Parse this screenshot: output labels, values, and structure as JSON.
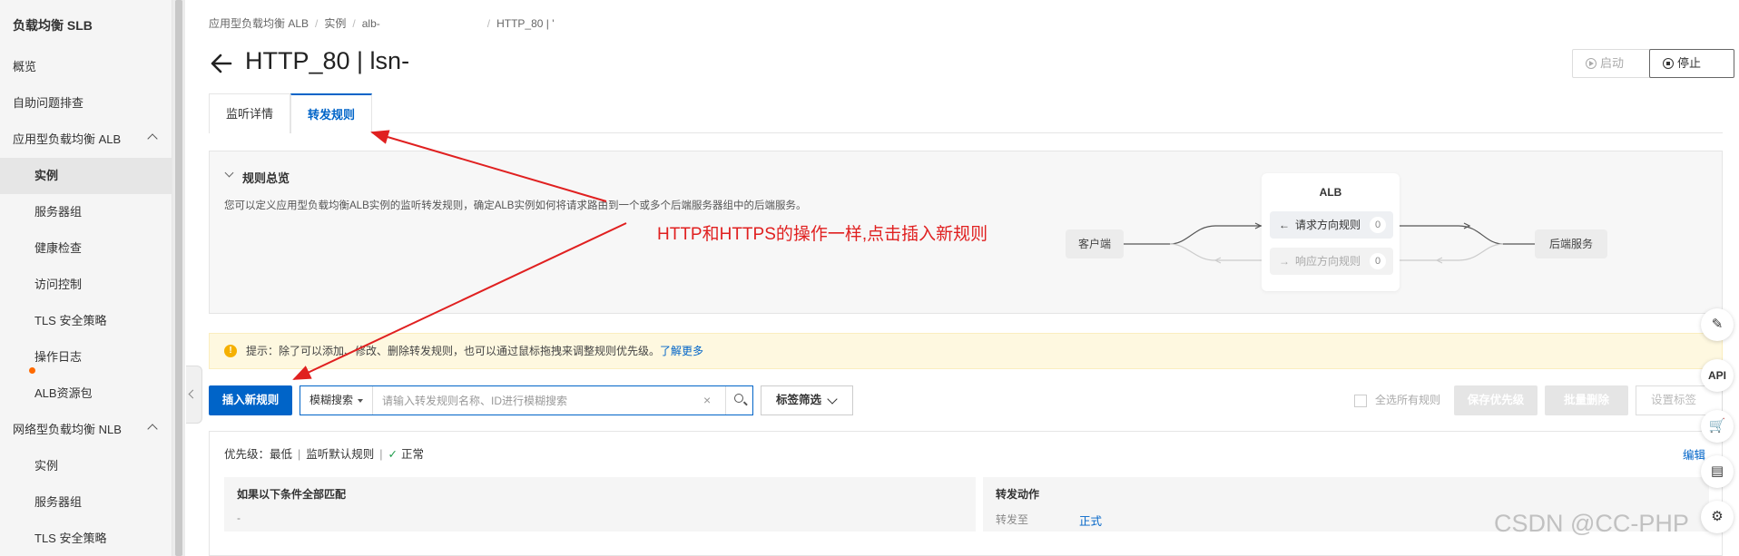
{
  "sidebar": {
    "title": "负载均衡 SLB",
    "items": [
      {
        "label": "概览"
      },
      {
        "label": "自助问题排查"
      },
      {
        "label": "应用型负载均衡 ALB"
      },
      {
        "label": "实例"
      },
      {
        "label": "服务器组"
      },
      {
        "label": "健康检查"
      },
      {
        "label": "访问控制"
      },
      {
        "label": "TLS 安全策略"
      },
      {
        "label": "操作日志"
      },
      {
        "label": "ALB资源包"
      },
      {
        "label": "网络型负载均衡 NLB"
      },
      {
        "label": "实例"
      },
      {
        "label": "服务器组"
      },
      {
        "label": "TLS 安全策略"
      }
    ]
  },
  "breadcrumb": {
    "items": [
      "应用型负载均衡 ALB",
      "实例",
      "alb-",
      "HTTP_80 | '"
    ]
  },
  "header": {
    "title": "HTTP_80 | lsn-",
    "start_label": "启动",
    "stop_label": "停止"
  },
  "tabs": [
    {
      "label": "监听详情"
    },
    {
      "label": "转发规则"
    }
  ],
  "overview": {
    "title": "规则总览",
    "desc": "您可以定义应用型负载均衡ALB实例的监听转发规则，确定ALB实例如何将请求路由到一个或多个后端服务器组中的后端服务。",
    "client": "客户端",
    "alb": "ALB",
    "request_dir": "请求方向规则",
    "request_count": "0",
    "response_dir": "响应方向规则",
    "response_count": "0",
    "backend": "后端服务"
  },
  "annotation": "HTTP和HTTPS的操作一样,点击插入新规则",
  "tip": {
    "text": "提示：除了可以添加、修改、删除转发规则，也可以通过鼠标拖拽来调整规则优先级。",
    "link": "了解更多"
  },
  "toolbar": {
    "insert_label": "插入新规则",
    "search_mode": "模糊搜索",
    "search_placeholder": "请输入转发规则名称、ID进行模糊搜索",
    "tag_filter": "标签筛选",
    "select_all": "全选所有规则",
    "save_priority": "保存优先级",
    "batch_delete": "批量删除",
    "set_tags": "设置标签"
  },
  "rule": {
    "priority": "优先级：最低",
    "name": "监听默认规则",
    "status": "正常",
    "edit": "编辑",
    "condition_header": "如果以下条件全部匹配",
    "condition_value": "-",
    "action_header": "转发动作",
    "action_type": "转发至",
    "action_target": "正式"
  },
  "float": {
    "api": "API"
  },
  "watermark": "CSDN @CC-PHP",
  "colors": {
    "primary": "#0064c8",
    "annotation": "#e02020",
    "tip_bg": "#fef8e0"
  }
}
